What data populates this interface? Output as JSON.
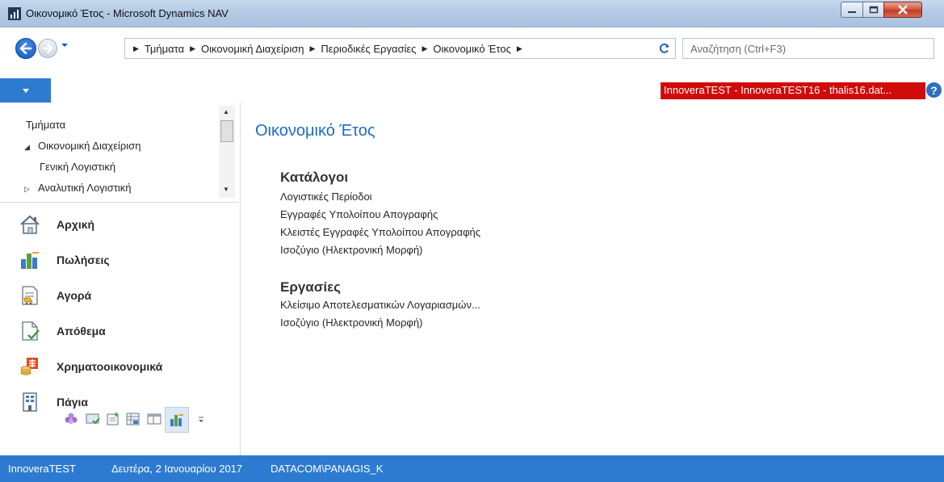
{
  "window": {
    "title": "Οικονομικό Έτος - Microsoft Dynamics NAV"
  },
  "navigation": {
    "breadcrumbs": [
      "Τμήματα",
      "Οικονομική Διαχείριση",
      "Περιοδικές Εργασίες",
      "Οικονομικό Έτος"
    ],
    "search_placeholder": "Αναζήτηση (Ctrl+F3)"
  },
  "company_banner": "InnoveraTEST - InnoveraTEST16 - thalis16.dat...",
  "tree": {
    "items": [
      {
        "label": "Τμήματα",
        "arrow": ""
      },
      {
        "label": "Οικονομική Διαχείριση",
        "arrow": "◢"
      },
      {
        "label": "Γενική Λογιστική",
        "arrow": ""
      },
      {
        "label": "Αναλυτική Λογιστική",
        "arrow": "▷"
      }
    ]
  },
  "role_center": {
    "items": [
      {
        "label": "Αρχική",
        "icon": "home-icon"
      },
      {
        "label": "Πωλήσεις",
        "icon": "sales-chart-icon"
      },
      {
        "label": "Αγορά",
        "icon": "purchase-document-icon"
      },
      {
        "label": "Απόθεμα",
        "icon": "inventory-check-icon"
      },
      {
        "label": "Χρηματοοικονομικά",
        "icon": "finance-icon"
      },
      {
        "label": "Πάγια",
        "icon": "fixed-assets-icon"
      }
    ]
  },
  "content": {
    "title": "Οικονομικό Έτος",
    "groups": [
      {
        "title": "Κατάλογοι",
        "links": [
          "Λογιστικές Περίοδοι",
          "Εγγραφές Υπολοίπου Απογραφής",
          "Κλειστές Εγγραφές Υπολοίπου Απογραφής",
          "Ισοζύγιο (Ηλεκτρονική Μορφή)"
        ]
      },
      {
        "title": "Εργασίες",
        "links": [
          "Κλείσιμο Αποτελεσματικών Λογαριασμών...",
          "Ισοζύγιο (Ηλεκτρονική Μορφή)"
        ]
      }
    ]
  },
  "status_bar": {
    "company": "InnoveraTEST",
    "date": "Δευτέρα, 2 Ιανουαρίου 2017",
    "user": "DATACOM\\PANAGIS_K"
  },
  "colors": {
    "accent_blue": "#2d7bd1",
    "title_blue": "#1d6bc7",
    "banner_red": "#d10a0a"
  }
}
